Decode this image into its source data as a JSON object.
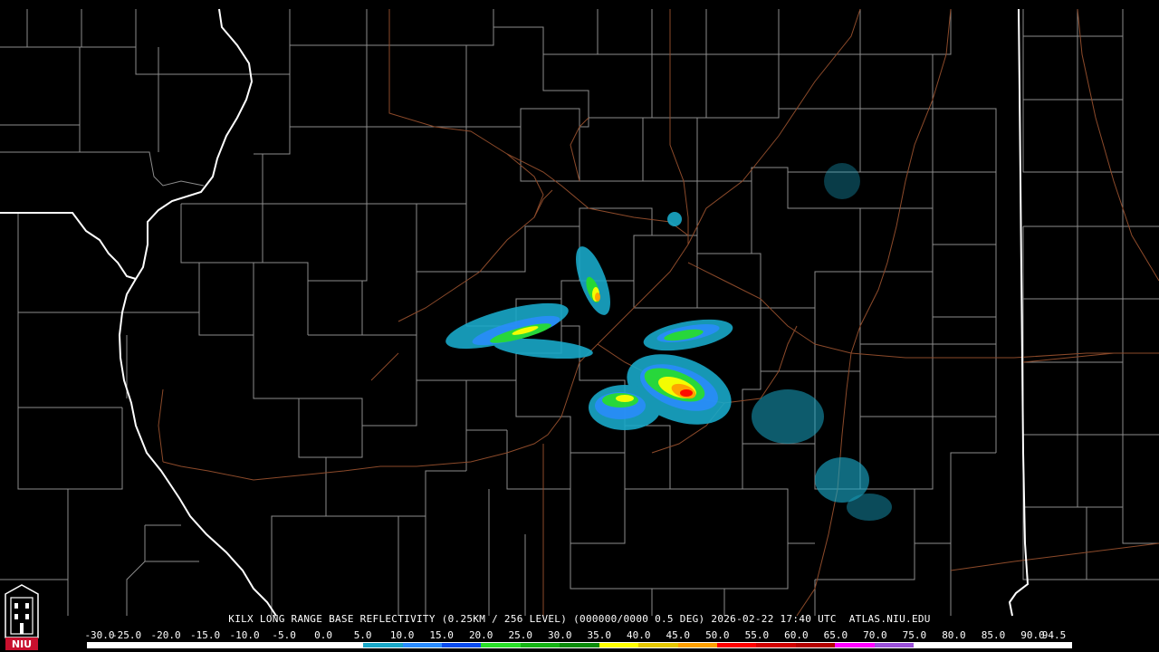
{
  "header": {
    "radar_id": "KILX",
    "product": "LONG RANGE BASE REFLECTIVITY",
    "resolution": "(0.25KM / 256 LEVEL)",
    "volume": "(000000/0000 0.5 DEG)",
    "timestamp": "2026-02-22 17:40 UTC",
    "site": "ATLAS.NIU.EDU"
  },
  "logo": {
    "text": "NIU",
    "icon": "university-tower-logo"
  },
  "legend": {
    "labels": [
      "-30.0",
      "-25.0",
      "-20.0",
      "-15.0",
      "-10.0",
      "-5.0",
      "0.0",
      "5.0",
      "10.0",
      "15.0",
      "20.0",
      "25.0",
      "30.0",
      "35.0",
      "40.0",
      "45.0",
      "50.0",
      "55.0",
      "60.0",
      "65.0",
      "70.0",
      "75.0",
      "80.0",
      "85.0",
      "90.0",
      "94.5"
    ],
    "colors": [
      "#ffffff",
      "#ffffff",
      "#ffffff",
      "#ffffff",
      "#ffffff",
      "#ffffff",
      "#ffffff",
      "#19a8c8",
      "#2a8cff",
      "#0a4cf0",
      "#28e028",
      "#14b414",
      "#0a8c0a",
      "#ffff00",
      "#e6c800",
      "#ffa000",
      "#ff0000",
      "#d20000",
      "#b40000",
      "#ff00ff",
      "#9a50d8",
      "#ffffff",
      "#ffffff",
      "#ffffff",
      "#ffffff"
    ]
  },
  "map_colors": {
    "background": "#000000",
    "county_lines": "#8c8c8c",
    "state_lines": "#ffffff",
    "highways": "#8c4a2a"
  }
}
